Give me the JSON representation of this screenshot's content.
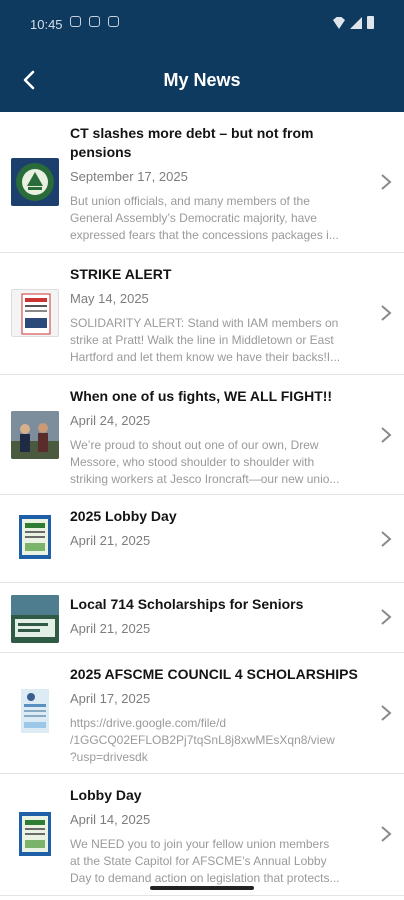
{
  "status_bar": {
    "time": "10:45"
  },
  "header": {
    "title": "My News",
    "back_icon": "back-chevron-icon"
  },
  "colors": {
    "header_bg": "#0f3a5f",
    "title_text": "#141414",
    "meta_text": "#7d7d7d",
    "chevron": "#8a8a8a"
  },
  "items": [
    {
      "title_lines": [
        "CT slashes more debt – but not from",
        "pensions"
      ],
      "date": "September 17, 2025",
      "excerpt_lines": [
        "But union officials, and many members of the",
        "General Assembly’s Democratic majority, have",
        "expressed fears that the concessions packages i..."
      ]
    },
    {
      "title_lines": [
        "STRIKE ALERT"
      ],
      "date": "May 14, 2025",
      "excerpt_lines": [
        "SOLIDARITY ALERT: Stand with IAM members on",
        "strike at Pratt! Walk the line in Middletown or East",
        "Hartford and let them know we have their backs!I..."
      ]
    },
    {
      "title_lines": [
        "When one of us fights, WE ALL FIGHT!!"
      ],
      "date": "April 24, 2025",
      "excerpt_lines": [
        "We’re proud to shout out one of our own, Drew",
        "Messore, who stood shoulder to shoulder with",
        "striking workers at Jesco Ironcraft—our new unio..."
      ]
    },
    {
      "title_lines": [
        "2025 Lobby Day"
      ],
      "date": "April 21, 2025",
      "excerpt_lines": []
    },
    {
      "title_lines": [
        "Local 714 Scholarships for Seniors"
      ],
      "date": "April 21, 2025",
      "excerpt_lines": []
    },
    {
      "title_lines": [
        "2025 AFSCME COUNCIL 4 SCHOLARSHIPS"
      ],
      "date": "April 17, 2025",
      "excerpt_lines": [
        "https://drive.google.com/file/d",
        "/1GGCQ02EFLOB2Pj7tqSnL8j8xwMEsXqn8/view",
        "?usp=drivesdk"
      ]
    },
    {
      "title_lines": [
        "Lobby Day"
      ],
      "date": "April 14, 2025",
      "excerpt_lines": [
        "We NEED you to join your fellow union members",
        "at the State Capitol for AFSCME’s Annual Lobby",
        "Day to demand action on legislation that protects..."
      ]
    }
  ]
}
